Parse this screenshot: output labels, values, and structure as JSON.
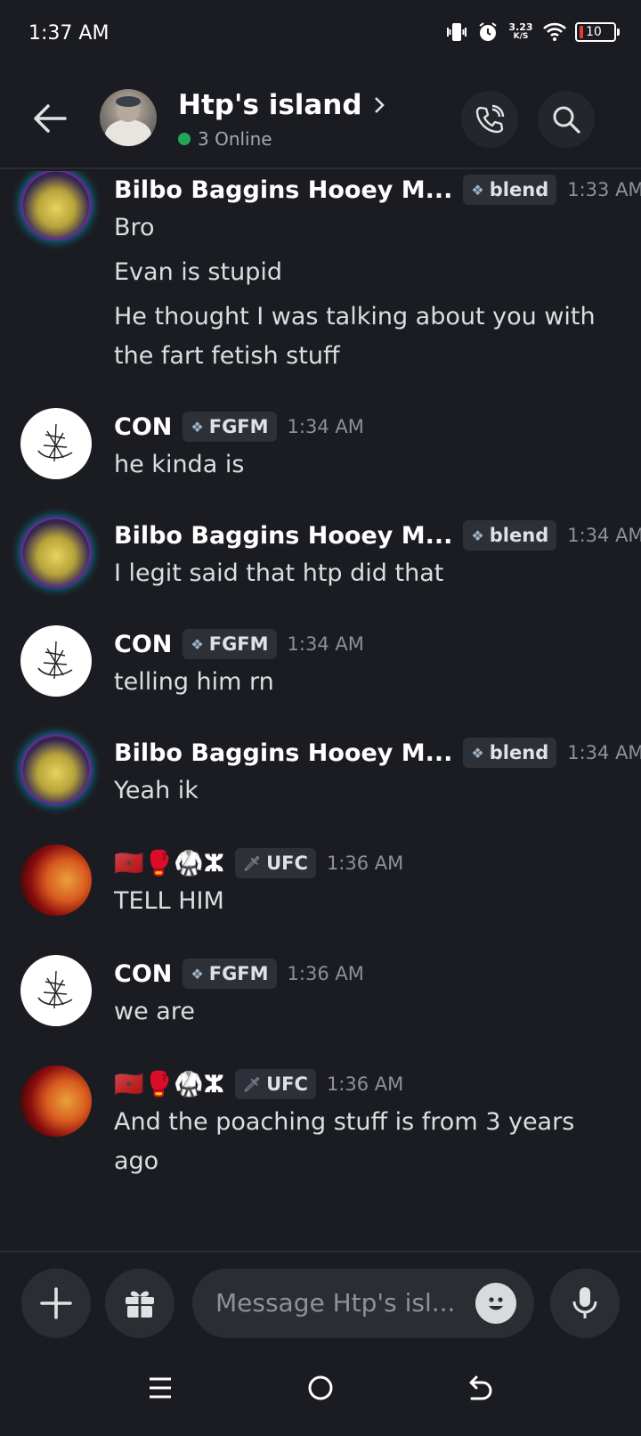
{
  "status": {
    "time": "1:37 AM",
    "net_speed": "3.23",
    "net_unit": "K/S",
    "battery": "10"
  },
  "header": {
    "title": "Htp's island",
    "online": "3 Online"
  },
  "messages": [
    {
      "user": "Bilbo Baggins Hooey M...",
      "tag": "blend",
      "time": "1:33 AM",
      "lines": [
        "Bro",
        "Evan is stupid",
        "He thought I was talking about you with the fart fetish stuff"
      ]
    },
    {
      "user": "CON",
      "tag": "FGFM",
      "time": "1:34 AM",
      "lines": [
        "he kinda is"
      ]
    },
    {
      "user": "Bilbo Baggins Hooey M...",
      "tag": "blend",
      "time": "1:34 AM",
      "lines": [
        "I legit said that htp did that"
      ]
    },
    {
      "user": "CON",
      "tag": "FGFM",
      "time": "1:34 AM",
      "lines": [
        "telling him rn"
      ]
    },
    {
      "user": "Bilbo Baggins Hooey M...",
      "tag": "blend",
      "time": "1:34 AM",
      "lines": [
        "Yeah ik"
      ]
    },
    {
      "user": "🇲🇦🥊🥋ⵣ",
      "tag": "UFC",
      "time": "1:36 AM",
      "lines": [
        "TELL HIM"
      ]
    },
    {
      "user": "CON",
      "tag": "FGFM",
      "time": "1:36 AM",
      "lines": [
        "we are"
      ]
    },
    {
      "user": "🇲🇦🥊🥋ⵣ",
      "tag": "UFC",
      "time": "1:36 AM",
      "lines": [
        "And the poaching stuff is from 3 years ago"
      ]
    }
  ],
  "composer": {
    "placeholder": "Message Htp's isl..."
  },
  "colors": {
    "background": "#1b1c21",
    "online": "#23a55a",
    "tag_bg": "#2e3037"
  }
}
